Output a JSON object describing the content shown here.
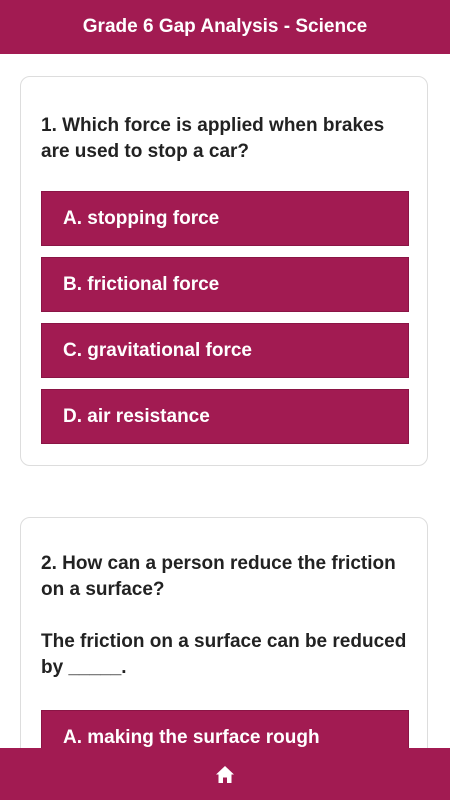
{
  "header": {
    "title": "Grade 6 Gap Analysis - Science"
  },
  "questions": [
    {
      "text": "1. Which force is applied when brakes are used to stop a car?",
      "options": [
        "A. stopping force",
        "B. frictional force",
        "C. gravitational force",
        "D. air resistance"
      ]
    },
    {
      "text": "2. How can a person reduce the friction on a surface?",
      "subtext": "The friction on a surface can be reduced by _____.",
      "options": [
        "A. making the surface rough"
      ]
    }
  ],
  "footer": {
    "icon": "home-icon"
  },
  "colors": {
    "accent": "#a21b52",
    "text": "#222222",
    "card_border": "#dddddd"
  }
}
